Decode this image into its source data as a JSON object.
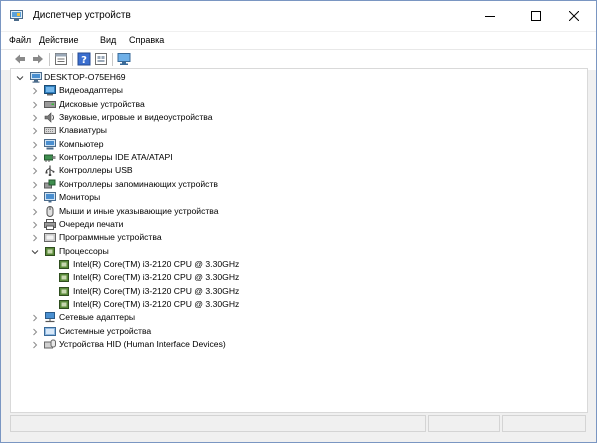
{
  "window": {
    "title": "Диспетчер устройств",
    "controls": {
      "minimize": "—",
      "maximize": "☐",
      "close": "✕"
    }
  },
  "menu": {
    "items": [
      "Файл",
      "Действие",
      "Вид",
      "Справка"
    ]
  },
  "toolbar": {
    "buttons": [
      "back-arrow-icon",
      "forward-arrow-icon",
      "properties-icon",
      "help-icon",
      "show-hidden-icon",
      "monitor-scan-icon"
    ]
  },
  "tree": {
    "root": "DESKTOP-O75EH69",
    "categories": [
      {
        "label": "Видеоадаптеры",
        "icon": "display-adapter-icon",
        "expanded": false
      },
      {
        "label": "Дисковые устройства",
        "icon": "disk-drive-icon",
        "expanded": false
      },
      {
        "label": "Звуковые, игровые и видеоустройства",
        "icon": "speaker-icon",
        "expanded": false
      },
      {
        "label": "Клавиатуры",
        "icon": "keyboard-icon",
        "expanded": false
      },
      {
        "label": "Компьютер",
        "icon": "computer-icon",
        "expanded": false
      },
      {
        "label": "Контроллеры IDE ATA/ATAPI",
        "icon": "ide-controller-icon",
        "expanded": false
      },
      {
        "label": "Контроллеры USB",
        "icon": "usb-icon",
        "expanded": false
      },
      {
        "label": "Контроллеры запоминающих устройств",
        "icon": "storage-controller-icon",
        "expanded": false
      },
      {
        "label": "Мониторы",
        "icon": "monitor-icon",
        "expanded": false
      },
      {
        "label": "Мыши и иные указывающие устройства",
        "icon": "mouse-icon",
        "expanded": false
      },
      {
        "label": "Очереди печати",
        "icon": "printer-icon",
        "expanded": false
      },
      {
        "label": "Программные устройства",
        "icon": "software-device-icon",
        "expanded": false
      },
      {
        "label": "Процессоры",
        "icon": "processor-icon",
        "expanded": true,
        "children": [
          "Intel(R) Core(TM) i3-2120 CPU @ 3.30GHz",
          "Intel(R) Core(TM) i3-2120 CPU @ 3.30GHz",
          "Intel(R) Core(TM) i3-2120 CPU @ 3.30GHz",
          "Intel(R) Core(TM) i3-2120 CPU @ 3.30GHz"
        ]
      },
      {
        "label": "Сетевые адаптеры",
        "icon": "network-adapter-icon",
        "expanded": false
      },
      {
        "label": "Системные устройства",
        "icon": "system-device-icon",
        "expanded": false
      },
      {
        "label": "Устройства HID (Human Interface Devices)",
        "icon": "hid-icon",
        "expanded": false
      }
    ]
  },
  "colors": {
    "window_border": "#7a96c2",
    "selection": "#cce8ff",
    "chrome": "#f0f0f0"
  }
}
